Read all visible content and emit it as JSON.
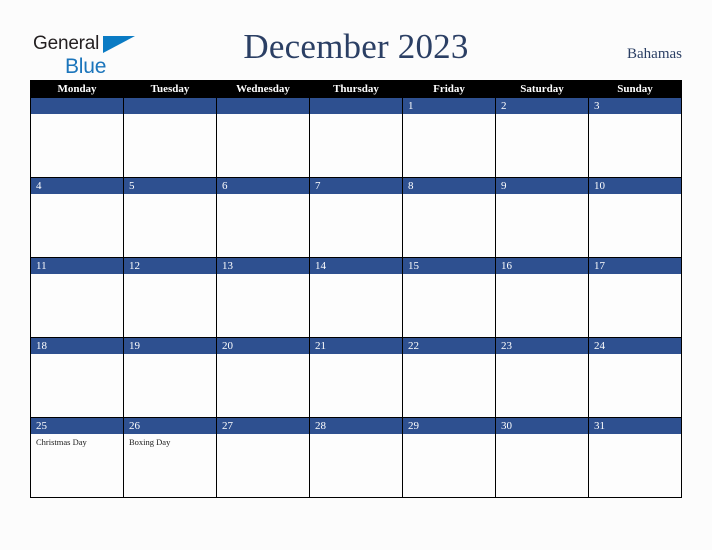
{
  "logo": {
    "name_part1": "General",
    "name_part2": "Blue",
    "triangle_icon": "blue-triangle-icon",
    "color_dark": "#231f20",
    "color_blue": "#1b75bb"
  },
  "header": {
    "title": "December 2023",
    "country": "Bahamas",
    "title_color": "#2b3f64"
  },
  "colors": {
    "header_row_bg": "#000000",
    "header_row_text": "#ffffff",
    "date_bar_bg": "#2e5090",
    "date_bar_text": "#ffffff",
    "cell_bg": "#ffffff",
    "page_bg": "#fcfcfc",
    "grid_line": "#000000"
  },
  "calendar": {
    "month": "December",
    "year": "2023",
    "weekday_headers": [
      "Monday",
      "Tuesday",
      "Wednesday",
      "Thursday",
      "Friday",
      "Saturday",
      "Sunday"
    ],
    "weeks": [
      [
        {
          "day": "",
          "holiday": ""
        },
        {
          "day": "",
          "holiday": ""
        },
        {
          "day": "",
          "holiday": ""
        },
        {
          "day": "",
          "holiday": ""
        },
        {
          "day": "1",
          "holiday": ""
        },
        {
          "day": "2",
          "holiday": ""
        },
        {
          "day": "3",
          "holiday": ""
        }
      ],
      [
        {
          "day": "4",
          "holiday": ""
        },
        {
          "day": "5",
          "holiday": ""
        },
        {
          "day": "6",
          "holiday": ""
        },
        {
          "day": "7",
          "holiday": ""
        },
        {
          "day": "8",
          "holiday": ""
        },
        {
          "day": "9",
          "holiday": ""
        },
        {
          "day": "10",
          "holiday": ""
        }
      ],
      [
        {
          "day": "11",
          "holiday": ""
        },
        {
          "day": "12",
          "holiday": ""
        },
        {
          "day": "13",
          "holiday": ""
        },
        {
          "day": "14",
          "holiday": ""
        },
        {
          "day": "15",
          "holiday": ""
        },
        {
          "day": "16",
          "holiday": ""
        },
        {
          "day": "17",
          "holiday": ""
        }
      ],
      [
        {
          "day": "18",
          "holiday": ""
        },
        {
          "day": "19",
          "holiday": ""
        },
        {
          "day": "20",
          "holiday": ""
        },
        {
          "day": "21",
          "holiday": ""
        },
        {
          "day": "22",
          "holiday": ""
        },
        {
          "day": "23",
          "holiday": ""
        },
        {
          "day": "24",
          "holiday": ""
        }
      ],
      [
        {
          "day": "25",
          "holiday": "Christmas Day"
        },
        {
          "day": "26",
          "holiday": "Boxing Day"
        },
        {
          "day": "27",
          "holiday": ""
        },
        {
          "day": "28",
          "holiday": ""
        },
        {
          "day": "29",
          "holiday": ""
        },
        {
          "day": "30",
          "holiday": ""
        },
        {
          "day": "31",
          "holiday": ""
        }
      ]
    ]
  }
}
